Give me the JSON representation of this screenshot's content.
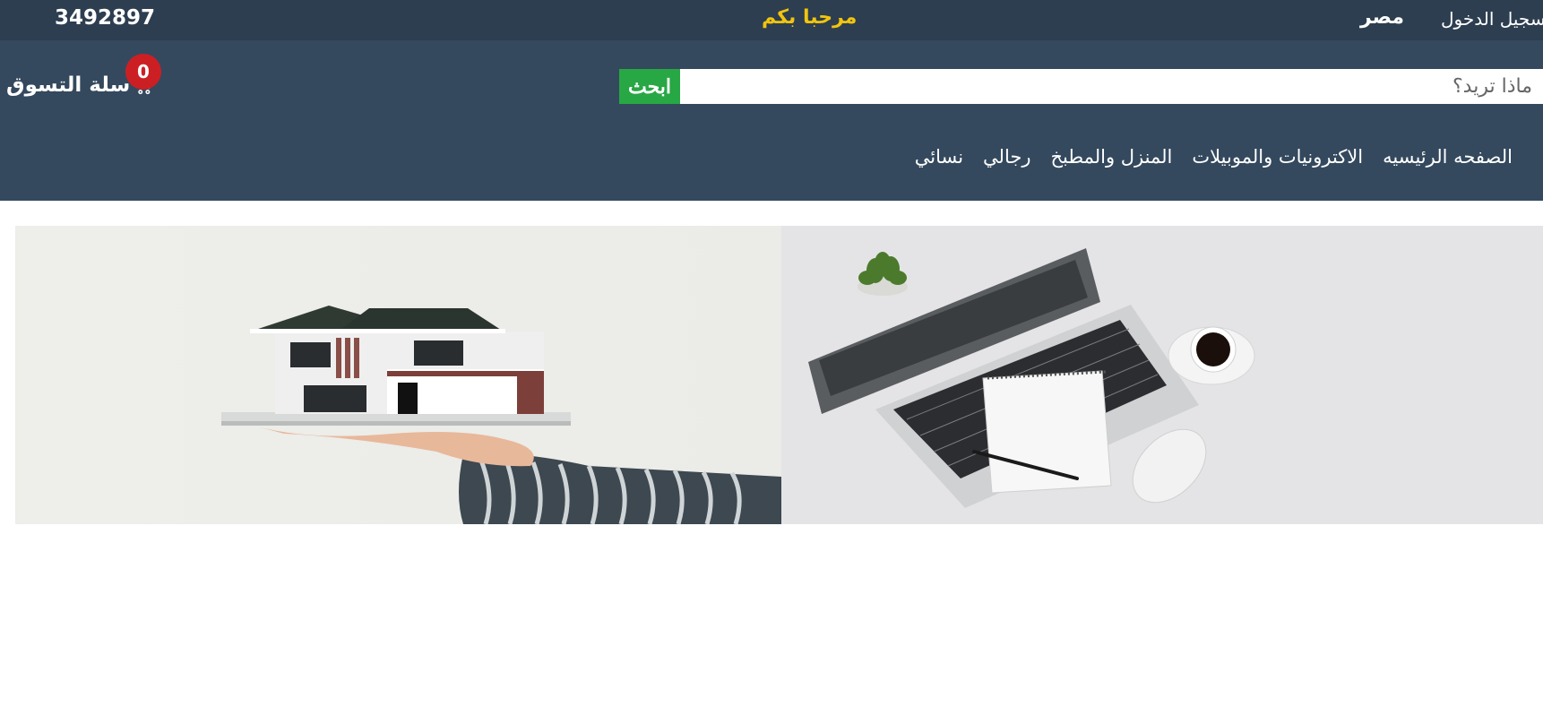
{
  "topbar": {
    "phone": "3492897",
    "welcome": "مرحبا بكم",
    "country": "مصر",
    "login": "تسجيل الدخول"
  },
  "cart": {
    "label": "سلة التسوق",
    "count": "0"
  },
  "search": {
    "placeholder": "ماذا تريد؟",
    "button": "ابحث"
  },
  "nav": {
    "items": [
      "الصفحه الرئيسيه",
      "الاكترونيات والموبيلات",
      "المنزل والمطبخ",
      "رجالي",
      "نسائي"
    ]
  },
  "icons": {
    "cart": "shopping-cart-icon"
  },
  "colors": {
    "topbar": "#2d3e50",
    "header": "#34495e",
    "welcome": "#f1c40f",
    "search_button": "#28a745",
    "badge": "#cc1f24"
  }
}
